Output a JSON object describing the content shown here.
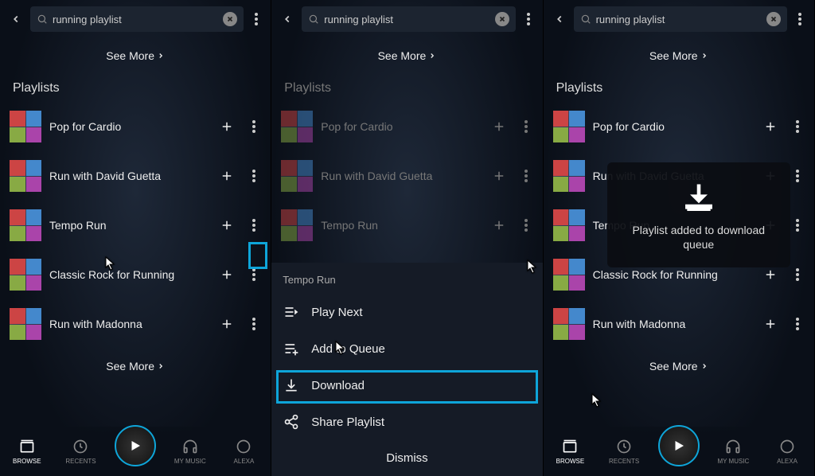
{
  "search": {
    "query": "running playlist"
  },
  "see_more": "See More",
  "section_title": "Playlists",
  "playlists": [
    {
      "name": "Pop for Cardio"
    },
    {
      "name": "Run with David Guetta"
    },
    {
      "name": "Tempo Run"
    },
    {
      "name": "Classic Rock for Running"
    },
    {
      "name": "Run with Madonna"
    }
  ],
  "context_menu": {
    "title": "Tempo Run",
    "items": [
      {
        "label": "Play Next"
      },
      {
        "label": "Add to Queue"
      },
      {
        "label": "Download"
      },
      {
        "label": "Share Playlist"
      }
    ],
    "dismiss": "Dismiss"
  },
  "toast": {
    "message": "Playlist added to download queue"
  },
  "bottom_nav": {
    "browse": "BROWSE",
    "recents": "RECENTS",
    "my_music": "MY MUSIC",
    "alexa": "ALEXA"
  },
  "colors": {
    "highlight": "#0ea5d9"
  }
}
